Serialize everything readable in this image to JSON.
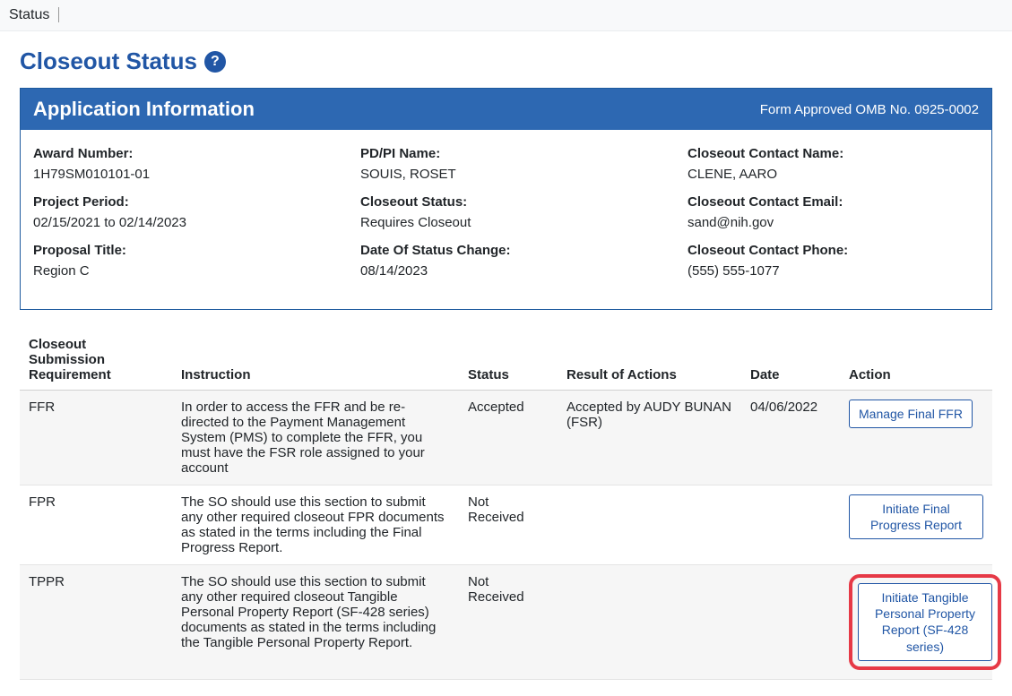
{
  "topbar": {
    "title": "Status"
  },
  "page": {
    "title": "Closeout Status"
  },
  "panel": {
    "header_title": "Application Information",
    "header_right": "Form Approved OMB No. 0925-0002"
  },
  "info": {
    "col1": [
      {
        "label": "Award Number:",
        "value": "1H79SM010101-01"
      },
      {
        "label": "Project Period:",
        "value": "02/15/2021 to 02/14/2023"
      },
      {
        "label": "Proposal Title:",
        "value": "Region C"
      }
    ],
    "col2": [
      {
        "label": "PD/PI Name:",
        "value": "SOUIS, ROSET"
      },
      {
        "label": "Closeout Status:",
        "value": "Requires Closeout"
      },
      {
        "label": "Date Of Status Change:",
        "value": "08/14/2023"
      }
    ],
    "col3": [
      {
        "label": "Closeout Contact Name:",
        "value": "CLENE, AARO"
      },
      {
        "label": "Closeout Contact Email:",
        "value": "sand@nih.gov"
      },
      {
        "label": "Closeout Contact Phone:",
        "value": "(555) 555-1077"
      }
    ]
  },
  "table": {
    "headers": {
      "requirement": "Closeout Submission Requirement",
      "instruction": "Instruction",
      "status": "Status",
      "result": "Result of Actions",
      "date": "Date",
      "action": "Action"
    },
    "rows": [
      {
        "requirement": "FFR",
        "instruction": "In order to access the FFR and be re-directed to the Payment Management System (PMS) to complete the FFR, you must have the FSR role assigned to your account",
        "status": "Accepted",
        "result": "Accepted by AUDY BUNAN (FSR)",
        "date": "04/06/2022",
        "action": "Manage Final FFR"
      },
      {
        "requirement": "FPR",
        "instruction": "The SO should use this section to submit any other required closeout FPR documents as stated in the terms including the Final Progress Report.",
        "status": "Not Received",
        "result": "",
        "date": "",
        "action": "Initiate Final Progress Report"
      },
      {
        "requirement": "TPPR",
        "instruction": "The SO should use this section to submit any other required closeout Tangible Personal Property Report (SF-428 series) documents as stated in the terms including the Tangible Personal Property Report.",
        "status": "Not Received",
        "result": "",
        "date": "",
        "action": "Initiate Tangible Personal Property Report (SF-428 series)"
      }
    ]
  }
}
